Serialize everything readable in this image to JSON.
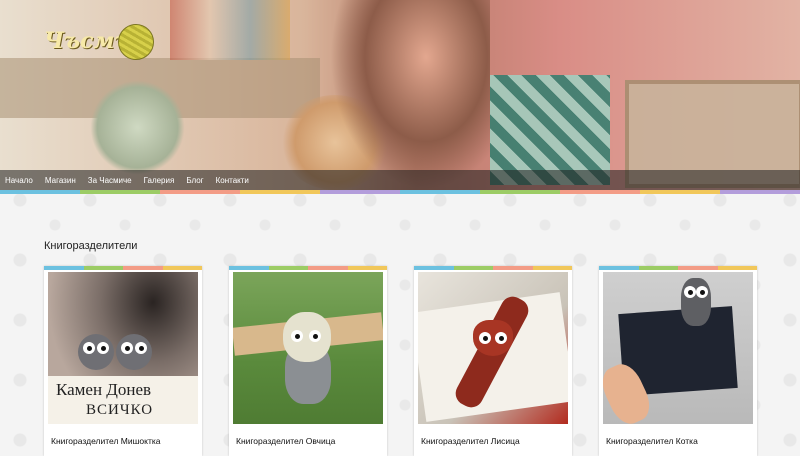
{
  "brand": {
    "logo_text": "Чъсмъ"
  },
  "nav": [
    {
      "label": "Начало"
    },
    {
      "label": "Магазин"
    },
    {
      "label": "За Часмиче"
    },
    {
      "label": "Галерия"
    },
    {
      "label": "Блог"
    },
    {
      "label": "Контакти"
    }
  ],
  "section": {
    "title": "Книгоразделители"
  },
  "products": [
    {
      "title": "Книгоразделител Мишоктка",
      "book_line1": "Камен Донев",
      "book_line2": "ВСИЧКО"
    },
    {
      "title": "Книгоразделител Овчица"
    },
    {
      "title": "Книгоразделител Лисица"
    },
    {
      "title": "Книгоразделител Котка"
    }
  ],
  "colors": {
    "stripe": [
      "#6cc1e0",
      "#9ccc65",
      "#f39c86",
      "#f1c75a",
      "#b39ddb"
    ]
  }
}
